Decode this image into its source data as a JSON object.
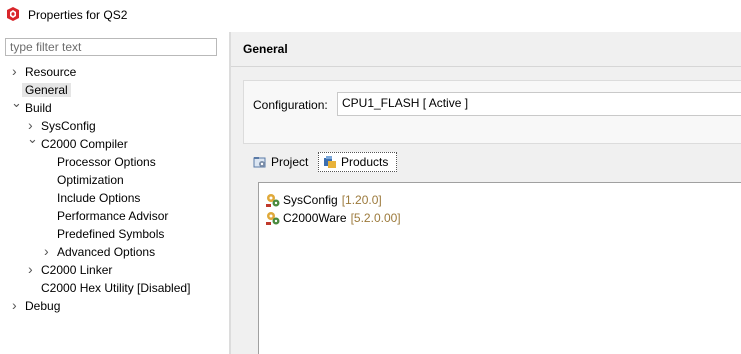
{
  "window": {
    "title": "Properties for QS2"
  },
  "filter": {
    "placeholder": "type filter text"
  },
  "tree": {
    "resource": "Resource",
    "general": "General",
    "build": "Build",
    "sysconfig": "SysConfig",
    "compiler": "C2000 Compiler",
    "processor_options": "Processor Options",
    "optimization": "Optimization",
    "include_options": "Include Options",
    "performance_advisor": "Performance Advisor",
    "predefined_symbols": "Predefined Symbols",
    "advanced_options": "Advanced Options",
    "linker": "C2000 Linker",
    "hex_utility": "C2000 Hex Utility  [Disabled]",
    "debug": "Debug"
  },
  "page": {
    "title": "General",
    "configuration_label": "Configuration:",
    "configuration_value": "CPU1_FLASH  [ Active ]"
  },
  "tabs": {
    "project": "Project",
    "products": "Products",
    "active": "Products"
  },
  "products": [
    {
      "name": "SysConfig",
      "version": "[1.20.0]"
    },
    {
      "name": "C2000Ware",
      "version": "[5.2.0.00]"
    }
  ],
  "colors": {
    "version_text": "#9c7a3c",
    "selection": "#e5e5e5",
    "app_icon": "#d9262b"
  }
}
